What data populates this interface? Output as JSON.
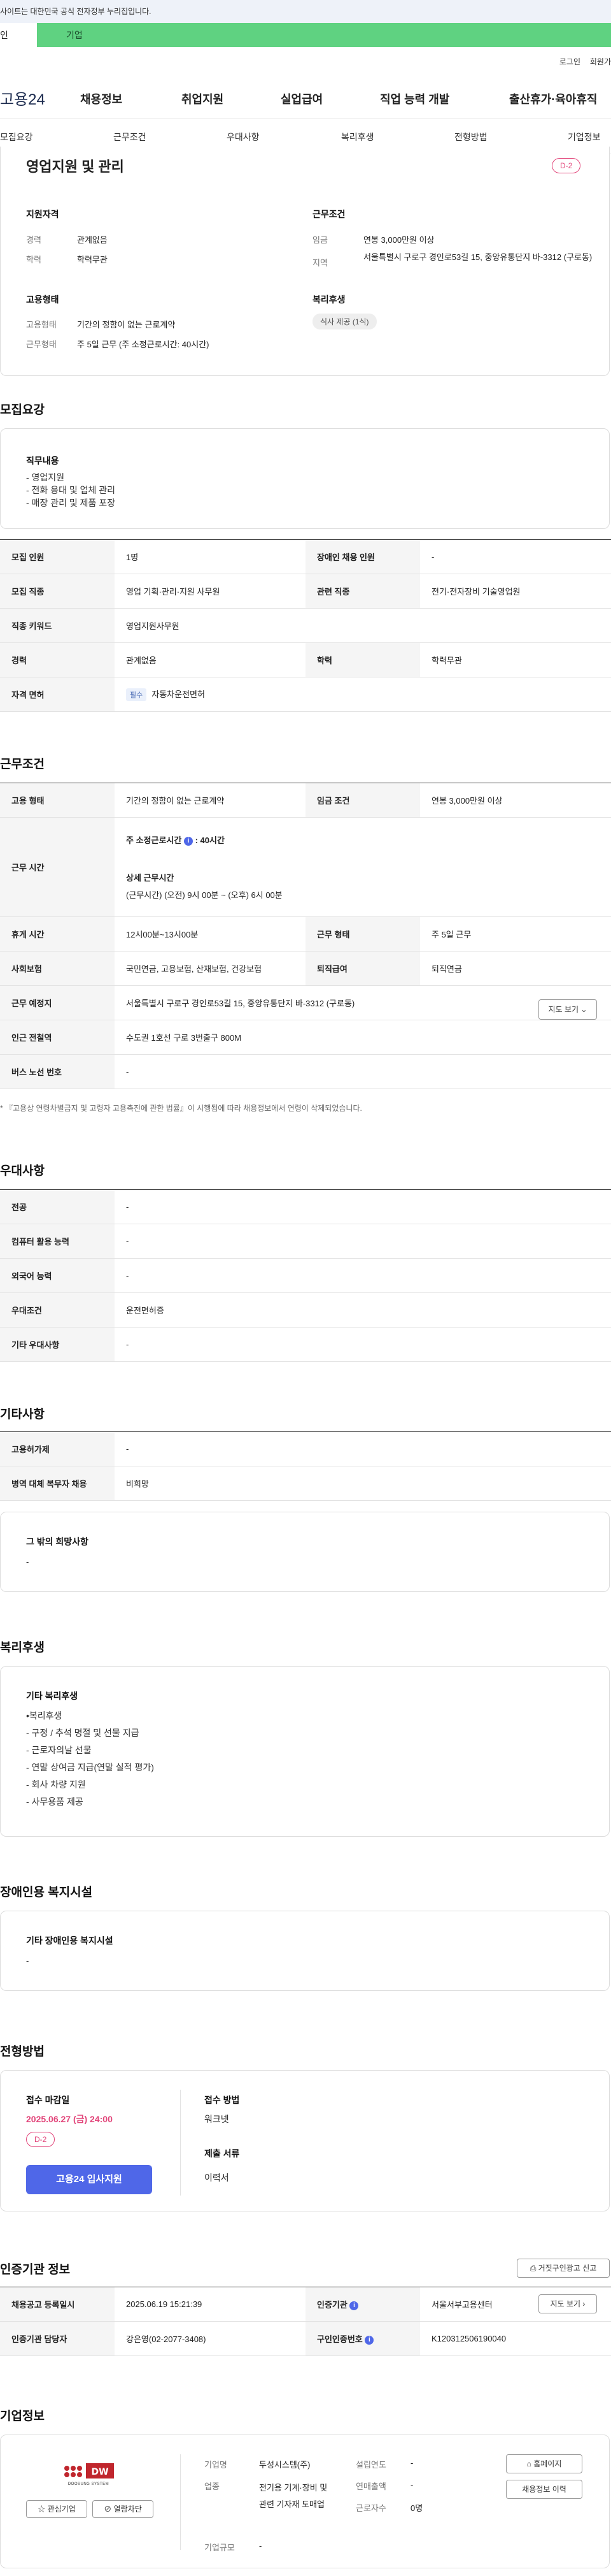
{
  "banner": {
    "text": "사이트는 대한민국 공식 전자정부 누리집입니다."
  },
  "member_tabs": {
    "person": "인",
    "company": "기업"
  },
  "util": {
    "login": "로그인",
    "join": "회원가"
  },
  "gnb": {
    "logo": "고용24",
    "menus": [
      "채용정보",
      "취업지원",
      "실업급여",
      "직업 능력 개발",
      "출산휴가·육아휴직"
    ]
  },
  "subnav": [
    "모집요강",
    "근무조건",
    "우대사항",
    "복리후생",
    "전형방법",
    "기업정보"
  ],
  "summary": {
    "title": "영업지원 및 관리",
    "dday": "D-2",
    "qualification": {
      "heading": "지원자격",
      "rows": [
        {
          "label": "경력",
          "value": "관계없음"
        },
        {
          "label": "학력",
          "value": "학력무관"
        }
      ]
    },
    "conditions": {
      "heading": "근무조건",
      "rows": [
        {
          "label": "임금",
          "value": "연봉 3,000만원 이상"
        },
        {
          "label": "지역",
          "value": "서울특별시 구로구 경인로53길 15, 중앙유통단지 바-3312 (구로동)"
        }
      ]
    },
    "employment": {
      "heading": "고용형태",
      "rows": [
        {
          "label": "고용형태",
          "value": "기간의 정함이 없는 근로계약"
        },
        {
          "label": "근무형태",
          "value": "주 5일 근무 (주 소정근로시간: 40시간)"
        }
      ]
    },
    "welfare": {
      "heading": "복리후생",
      "badge": "식사 제공 (1식)"
    }
  },
  "recruit": {
    "title": "모집요강",
    "duty_heading": "직무내용",
    "duties": [
      "- 영업지원",
      "- 전화 응대 및 업체 관리",
      "- 매장 관리 및 제품 포장"
    ],
    "table": {
      "headcount_label": "모집 인원",
      "headcount": "1명",
      "disabled_label": "장애인 채용 인원",
      "disabled": "-",
      "job_label": "모집 직종",
      "job": "영업 기획·관리·지원 사무원",
      "related_label": "관련 직종",
      "related": "전기·전자장비 기술영업원",
      "keyword_label": "직종 키워드",
      "keyword": "영업지원사무원",
      "career_label": "경력",
      "career": "관계없음",
      "edu_label": "학력",
      "edu": "학력무관",
      "license_label": "자격 면허",
      "license_badge": "필수",
      "license": "자동차운전면허"
    }
  },
  "work": {
    "title": "근무조건",
    "type_label": "고용 형태",
    "type": "기간의 정함이 없는 근로계약",
    "wage_label": "임금 조건",
    "wage": "연봉 3,000만원 이상",
    "hours_label": "근무 시간",
    "hours_std_label": "주 소정근로시간",
    "hours_std": ": 40시간",
    "hours_detail_label": "상세 근무시간",
    "hours_detail": "(근무시간) (오전) 9시 00분 ~ (오후) 6시 00분",
    "rest_label": "휴게 시간",
    "rest": "12시00분~13시00분",
    "shift_label": "근무 형태",
    "shift": "주 5일 근무",
    "insurance_label": "사회보험",
    "insurance": "국민연금, 고용보험, 산재보험, 건강보험",
    "retire_label": "퇴직급여",
    "retire": "퇴직연금",
    "place_label": "근무 예정지",
    "place": "서울특별시 구로구 경인로53길 15, 중앙유통단지 바-3312 (구로동)",
    "map_button": "지도 보기",
    "subway_label": "인근 전철역",
    "subway": "수도권 1호선 구로 3번출구 800M",
    "bus_label": "버스 노선 번호",
    "bus": "-",
    "note": "* 『고용상 연령차별금지 및 고령자 고용촉진에 관한 법률』이 시행됨에 따라 채용정보에서 연령이 삭제되었습니다."
  },
  "preference": {
    "title": "우대사항",
    "rows": [
      {
        "label": "전공",
        "value": "-"
      },
      {
        "label": "컴퓨터 활용 능력",
        "value": "-"
      },
      {
        "label": "외국어 능력",
        "value": "-"
      },
      {
        "label": "우대조건",
        "value": "운전면허증"
      },
      {
        "label": "기타 우대사항",
        "value": "-"
      }
    ]
  },
  "etc": {
    "title": "기타사항",
    "rows": [
      {
        "label": "고용허가제",
        "value": "-"
      },
      {
        "label": "병역 대체 복무자 채용",
        "value": "비희망"
      }
    ],
    "other_heading": "그 밖의 희망사항",
    "other_value": "-"
  },
  "benefit": {
    "title": "복리후생",
    "heading": "기타 복리후생",
    "items": [
      "•복리후생",
      "- 구정 / 추석 명절 및 선물 지급",
      "- 근로자의날 선물",
      "- 연말 상여금 지급(연말 실적 평가)",
      "- 회사 차량 지원",
      "- 사무용품 제공"
    ]
  },
  "disabled_facility": {
    "title": "장애인용 복지시설",
    "heading": "기타 장애인용 복지시설",
    "value": "-"
  },
  "selection": {
    "title": "전형방법",
    "deadline_label": "접수 마감일",
    "deadline": "2025.06.27 (금) 24:00",
    "dday": "D-2",
    "apply_button": "고용24 입사지원",
    "method_label": "접수 방법",
    "method": "워크넷",
    "docs_label": "제출 서류",
    "docs": "이력서"
  },
  "agency": {
    "title": "인증기관 정보",
    "report_button": "거짓구인광고 신고",
    "registered_label": "채용공고 등록일시",
    "registered": "2025.06.19 15:21:39",
    "agency_label": "인증기관",
    "agency": "서울서부고용센터",
    "map_button": "지도 보기",
    "manager_label": "인증기관 담당자",
    "manager": "강은영(02-2077-3408)",
    "number_label": "구인인증번호",
    "number": "K120312506190040"
  },
  "company": {
    "title": "기업정보",
    "logo_text": "DOOSUNG SYSTEM",
    "fav_button": "관심기업",
    "block_button": "열람차단",
    "name_label": "기업명",
    "name": "두성시스템(주)",
    "industry_label": "업종",
    "industry": "전기용 기계·장비 및 관련 기자재 도매업",
    "size_label": "기업규모",
    "size": "-",
    "founded_label": "설립연도",
    "founded": "-",
    "sales_label": "연매출액",
    "sales": "-",
    "employees_label": "근로자수",
    "employees": "0명",
    "homepage_button": "홈페이지",
    "jobs_button": "채용정보 이력"
  },
  "colors": {
    "accent": "#4f67e8",
    "dday": "#e2457a",
    "company_tab": "#5fd281"
  }
}
